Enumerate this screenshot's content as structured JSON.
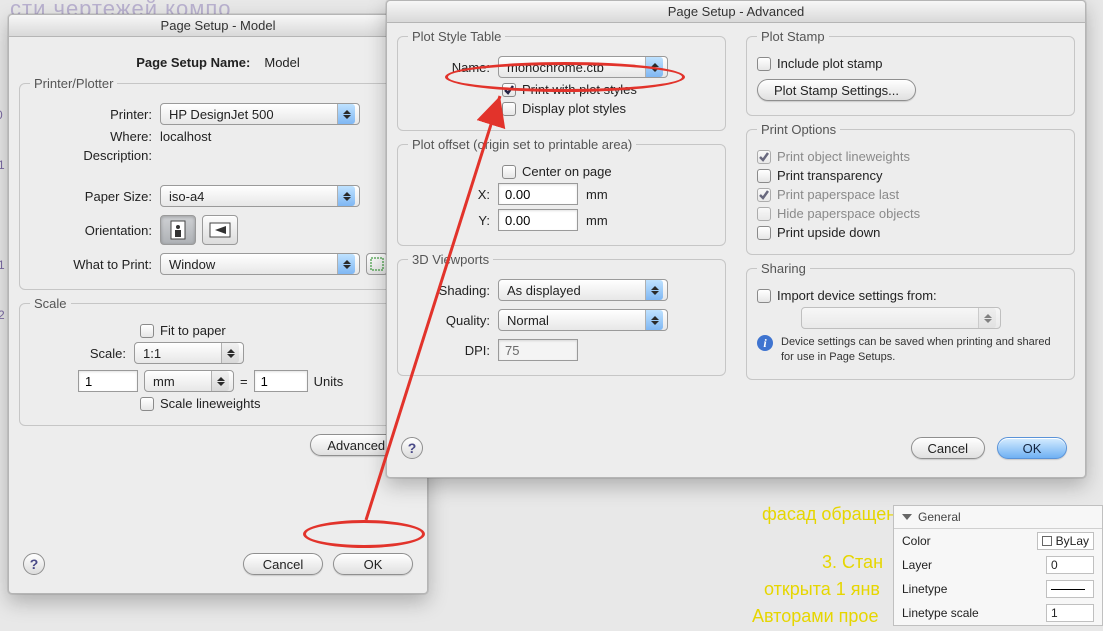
{
  "dialog_model": {
    "title": "Page Setup - Model",
    "page_setup_name_label": "Page Setup Name:",
    "page_setup_name_value": "Model",
    "printer_plotter": {
      "legend": "Printer/Plotter",
      "printer_label": "Printer:",
      "printer_value": "HP DesignJet 500",
      "where_label": "Where:",
      "where_value": "localhost",
      "description_label": "Description:",
      "paper_size_label": "Paper Size:",
      "paper_size_value": "iso-a4",
      "orientation_label": "Orientation:",
      "what_to_print_label": "What to Print:",
      "what_to_print_value": "Window"
    },
    "scale": {
      "legend": "Scale",
      "fit_to_paper_label": "Fit to paper",
      "scale_label": "Scale:",
      "scale_value": "1:1",
      "left_value": "1",
      "unit_select": "mm",
      "equals": "=",
      "right_value": "1",
      "units_label": "Units",
      "scale_lineweights_label": "Scale lineweights"
    },
    "advanced_button": "Advanced...",
    "cancel_button": "Cancel",
    "ok_button": "OK"
  },
  "dialog_advanced": {
    "title": "Page Setup - Advanced",
    "plot_style_table": {
      "legend": "Plot Style Table",
      "name_label": "Name:",
      "name_value": "monochrome.ctb",
      "print_with_styles": "Print with plot styles",
      "display_styles": "Display plot styles"
    },
    "plot_stamp": {
      "legend": "Plot Stamp",
      "include": "Include plot stamp",
      "settings_button": "Plot Stamp Settings..."
    },
    "plot_offset": {
      "legend": "Plot offset (origin set to printable area)",
      "center": "Center on page",
      "x_label": "X:",
      "x_value": "0.00",
      "y_label": "Y:",
      "y_value": "0.00",
      "unit": "mm"
    },
    "print_options": {
      "legend": "Print Options",
      "lineweights": "Print object lineweights",
      "transparency": "Print transparency",
      "paperspace": "Print paperspace last",
      "hide": "Hide paperspace objects",
      "upside": "Print upside down"
    },
    "viewports": {
      "legend": "3D Viewports",
      "shading_label": "Shading:",
      "shading_value": "As displayed",
      "quality_label": "Quality:",
      "quality_value": "Normal",
      "dpi_label": "DPI:",
      "dpi_value": "75"
    },
    "sharing": {
      "legend": "Sharing",
      "import": "Import device settings from:",
      "hint": "Device settings can be saved when printing and shared for use in Page Setups."
    },
    "cancel_button": "Cancel",
    "ok_button": "OK"
  },
  "props_panel": {
    "general": "General",
    "color_label": "Color",
    "color_value": "ByLay",
    "layer_label": "Layer",
    "layer_value": "0",
    "linetype_label": "Linetype",
    "lts_label": "Linetype scale",
    "lts_value": "1"
  },
  "bg": {
    "yellow1": "фасад обращен",
    "yellow2": "3. Стан",
    "yellow3": "открыта 1 янв",
    "yellow4": "Авторами прое",
    "ghost1": "сти чертежей компо"
  }
}
